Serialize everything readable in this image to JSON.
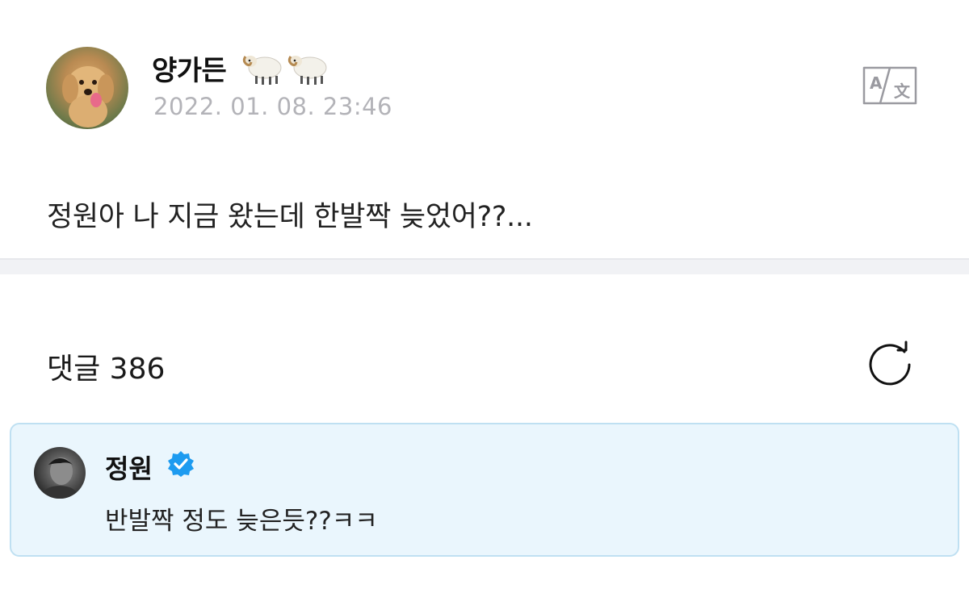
{
  "post": {
    "author_name": "양가든",
    "author_emojis": [
      "sheep",
      "sheep"
    ],
    "timestamp": "2022. 01. 08. 23:46",
    "body": "정원아 나 지금 왔는데 한발짝 늦었어??...",
    "translate_icon": "translate-icon"
  },
  "comments": {
    "title": "댓글 386",
    "refresh_icon": "refresh-icon"
  },
  "reply": {
    "author_name": "정원",
    "verified": true,
    "text": "반발짝 정도 늦은듯??ㅋㅋ"
  },
  "colors": {
    "reply_background": "#eaf6fd",
    "reply_border": "#bfe0f2",
    "verified_blue": "#1d9bf0",
    "timestamp_gray": "#b3b3b8"
  }
}
